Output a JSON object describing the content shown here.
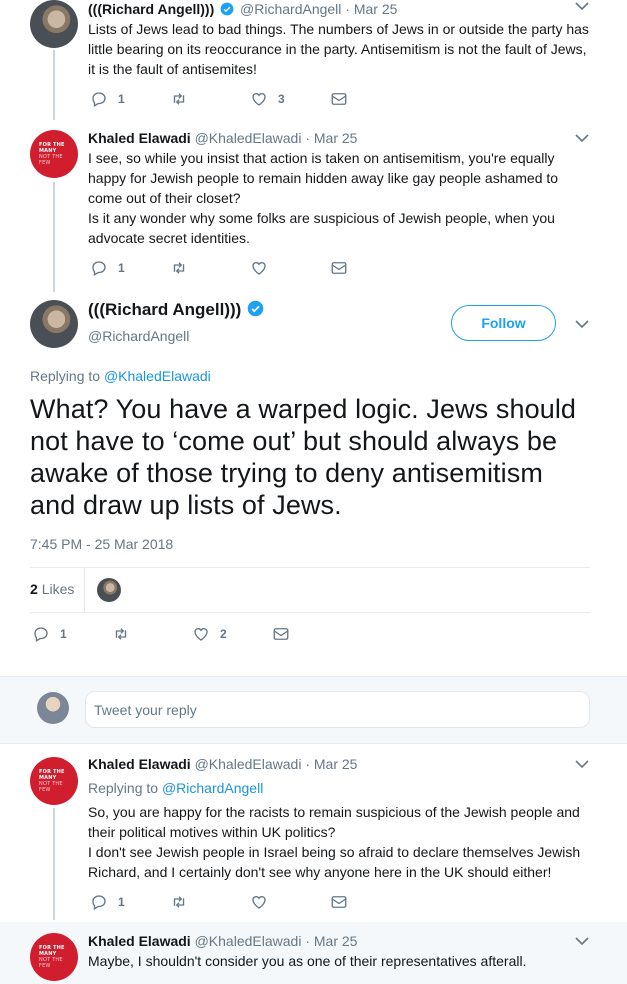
{
  "tweet1": {
    "name": "(((Richard Angell)))",
    "handle": "@RichardAngell",
    "separator": "·",
    "date": "Mar 25",
    "text_lines": [
      "Lists of Jews lead to bad things. The numbers of Jews in or outside the party has",
      "little bearing on its reoccurance in the party. Antisemitism is not the fault of Jews,",
      "it is the fault of antisemites!"
    ],
    "reply_count": "1",
    "retweet_count": "",
    "like_count": "3"
  },
  "tweet2": {
    "name": "Khaled Elawadi",
    "handle": "@KhaledElawadi",
    "separator": "·",
    "date": "Mar 25",
    "text_lines": [
      "I see, so while you insist that action is taken on antisemitism, you're equally",
      "happy for Jewish people to remain hidden away like gay people ashamed to",
      "come out of their closet?",
      "Is it any wonder why some folks are suspicious of Jewish people, when you",
      "advocate secret identities."
    ],
    "reply_count": "1",
    "retweet_count": "",
    "like_count": ""
  },
  "main": {
    "name": "(((Richard Angell)))",
    "handle": "@RichardAngell",
    "follow_label": "Follow",
    "replying_prefix": "Replying to",
    "replying_to": "@KhaledElawadi",
    "text_lines": [
      "What? You have a warped logic. Jews should",
      "not have to ‘come out’ but should always be",
      "awake of those trying to deny antisemitism",
      "and draw up lists of Jews."
    ],
    "timestamp": "7:45 PM - 25 Mar 2018",
    "likes_count": "2",
    "likes_label": "Likes",
    "reply_count": "1",
    "retweet_count": "",
    "like_count": "2"
  },
  "composer": {
    "placeholder": "Tweet your reply"
  },
  "tweet3": {
    "name": "Khaled Elawadi",
    "handle": "@KhaledElawadi",
    "separator": "·",
    "date": "Mar 25",
    "replying_prefix": "Replying to",
    "replying_to": "@RichardAngell",
    "text_lines": [
      "So, you are happy for the racists to remain suspicious of the Jewish people and",
      "their political motives within UK politics?",
      "I don't see Jewish people in Israel being so afraid to declare themselves Jewish",
      "Richard, and I certainly don't see why anyone here in the UK should either!"
    ],
    "reply_count": "1",
    "retweet_count": "",
    "like_count": ""
  },
  "tweet4": {
    "name": "Khaled Elawadi",
    "handle": "@KhaledElawadi",
    "separator": "·",
    "date": "Mar 25",
    "text_lines": [
      "Maybe, I shouldn't consider you as one of their representatives afterall."
    ]
  },
  "avatar_badge": {
    "line1": "FOR THE",
    "line2": "MANY",
    "line3": "NOT THE",
    "line4": "FEW"
  },
  "colors": {
    "accent": "#1da1f2",
    "link": "#1b95e0",
    "muted": "#657786",
    "badge_red": "#d01e2f"
  }
}
